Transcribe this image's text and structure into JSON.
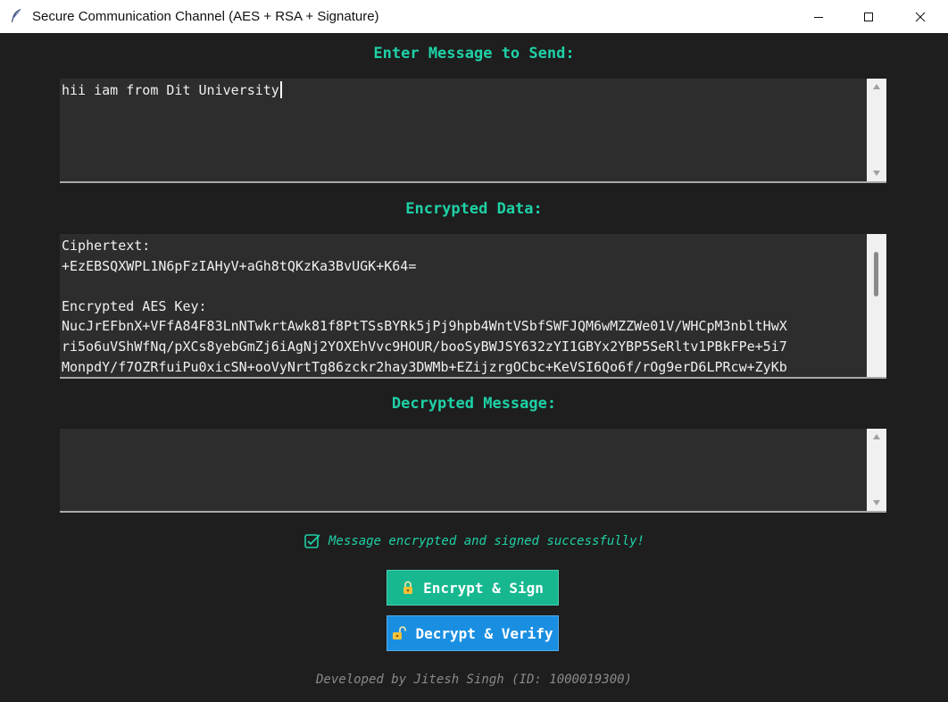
{
  "window": {
    "title": "Secure Communication Channel (AES + RSA + Signature)",
    "icon": "feather-icon"
  },
  "send": {
    "heading": "Enter Message to Send:",
    "value": "hii iam from Dit University"
  },
  "encrypted": {
    "heading": "Encrypted Data:",
    "lines": [
      "Ciphertext:",
      "+EzEBSQXWPL1N6pFzIAHyV+aGh8tQKzKa3BvUGK+K64=",
      "",
      "Encrypted AES Key:",
      "NucJrEFbnX+VFfA84F83LnNTwkrtAwk81f8PtTSsBYRk5jPj9hpb4WntVSbfSWFJQM6wMZZWe01V/WHCpM3nbltHwX",
      "ri5o6uVShWfNq/pXCs8yebGmZj6iAgNj2YOXEhVvc9HOUR/booSyBWJSY632zYI1GBYx2YBP5SeRltv1PBkFPe+5i7",
      "MonpdY/f7OZRfuiPu0xicSN+ooVyNrtTg86zckr2hay3DWMb+EZijzrgOCbc+KeVSI6Qo6f/rOg9erD6LPRcw+ZyKb"
    ]
  },
  "decrypted": {
    "heading": "Decrypted Message:",
    "value": ""
  },
  "status": {
    "icon": "checkbox-checked-icon",
    "text": "Message encrypted and signed successfully!"
  },
  "buttons": {
    "encrypt_label": "Encrypt & Sign",
    "encrypt_icon": "lock-icon",
    "decrypt_label": "Decrypt & Verify",
    "decrypt_icon": "unlock-icon"
  },
  "footer": "Developed by Jitesh Singh (ID: 1000019300)",
  "colors": {
    "background": "#1e1e1e",
    "accent": "#1ed1a6",
    "encrypt_button": "#17b890",
    "decrypt_button": "#1a8fe2",
    "text_field": "#2d2d2d",
    "footer_text": "#8a8a8a"
  }
}
